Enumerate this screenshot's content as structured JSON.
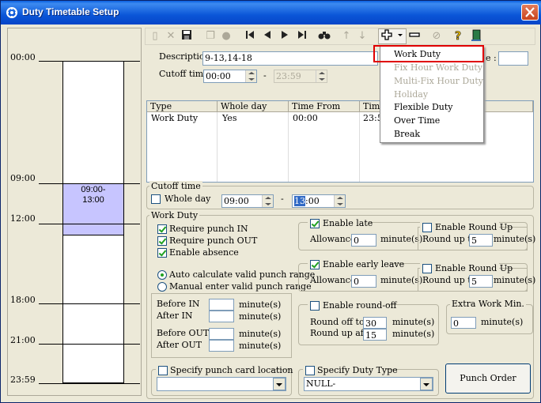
{
  "window": {
    "title": "Duty Timetable Setup"
  },
  "timeline": {
    "labels": [
      "00:00",
      "09:00",
      "12:00",
      "18:00",
      "21:00",
      "23:59"
    ],
    "block_label": "09:00-\n13:00"
  },
  "toolbar": {
    "icons": [
      "new-icon",
      "delete-icon",
      "save-icon",
      "copy-icon",
      "record-icon",
      "first-icon",
      "prev-icon",
      "next-icon",
      "last-icon",
      "find-icon",
      "up-icon",
      "down-icon",
      "add-icon",
      "dropdown-icon",
      "remove-icon",
      "cancel-icon",
      "help-icon",
      "exit-icon"
    ]
  },
  "form": {
    "description_label": "Description",
    "description_value": "9-13,14-18",
    "code_suffix_label": "e :",
    "code_value": "",
    "cutoff_label": "Cutoff time",
    "cutoff_from": "00:00",
    "cutoff_dash": "-",
    "cutoff_to": "23:59"
  },
  "grid": {
    "headers": [
      "Type",
      "Whole day",
      "Time From",
      "Time"
    ],
    "rows": [
      [
        "Work Duty",
        "Yes",
        "00:00",
        "23:5"
      ]
    ]
  },
  "add_menu": {
    "items": [
      {
        "label": "Work Duty",
        "enabled": true,
        "highlighted": true
      },
      {
        "label": "Fix Hour Work Duty",
        "enabled": false
      },
      {
        "label": "Multi-Fix Hour Duty",
        "enabled": false
      },
      {
        "label": "Holiday",
        "enabled": false
      },
      {
        "label": "Flexible Duty",
        "enabled": true
      },
      {
        "label": "Over Time",
        "enabled": true
      },
      {
        "label": "Break",
        "enabled": true
      }
    ]
  },
  "cutoff_group": {
    "title": "Cutoff time",
    "whole_day_label": "Whole day",
    "whole_day_checked": false,
    "from": "09:00",
    "dash": "-",
    "to_selected": "13",
    "to_rest": ":00"
  },
  "work_duty": {
    "title": "Work Duty",
    "require_in": "Require punch IN",
    "require_out": "Require punch OUT",
    "enable_absence": "Enable absence",
    "auto_calc": "Auto calculate valid punch range",
    "manual_enter": "Manual enter valid punch range",
    "before_in": "Before IN",
    "after_in": "After IN",
    "before_out": "Before OUT",
    "after_out": "After OUT",
    "minutes": "minute(s)"
  },
  "late": {
    "label": "Enable late",
    "checked": true,
    "allowance_label": "Allowance",
    "allowance": "0",
    "minutes": "minute(s)",
    "round_up_label": "Enable Round Up",
    "round_up_to_label": "Round up to",
    "round_up_to": "5"
  },
  "early": {
    "label": "Enable early leave",
    "checked": true,
    "allowance_label": "Allowance",
    "allowance": "0",
    "minutes": "minute(s)",
    "round_up_label": "Enable Round Up",
    "round_up_to_label": "Round up to",
    "round_up_to": "5"
  },
  "round_off": {
    "label": "Enable round-off",
    "round_off_to_label": "Round off to",
    "round_off_to": "30",
    "round_up_after_label": "Round up after",
    "round_up_after": "15",
    "minutes": "minute(s)"
  },
  "extra": {
    "title": "Extra Work Min.",
    "value": "0",
    "minutes": "minute(s)"
  },
  "bottom": {
    "punch_location_label": "Specify punch card location",
    "punch_location_value": "",
    "duty_type_label": "Specify Duty Type",
    "duty_type_value": "NULL-",
    "punch_order_button": "Punch Order"
  },
  "colors": {
    "title_bar": "#0b56d8",
    "timeline_block": "#c7c5ff",
    "menu_highlight": "#e00000"
  }
}
